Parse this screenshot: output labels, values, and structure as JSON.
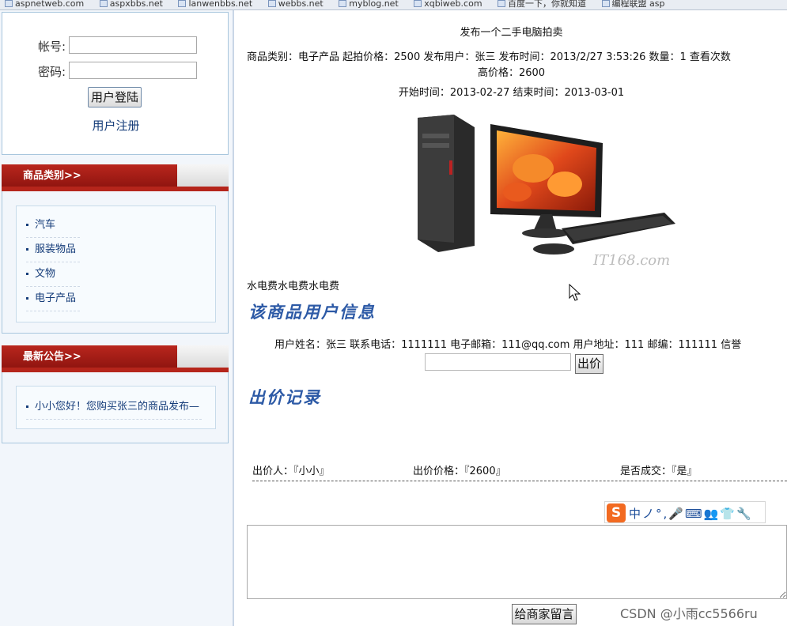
{
  "bookmarks": [
    "aspnetweb.com",
    "aspxbbs.net",
    "lanwenbbs.net",
    "webbs.net",
    "myblog.net",
    "xqbiweb.com",
    "百度一下，你就知道",
    "编程联盟 asp"
  ],
  "login": {
    "account_label": "帐号:",
    "password_label": "密码:",
    "login_button": "用户登陆",
    "register_link": "用户注册"
  },
  "categories_panel": {
    "title": "商品类别>>",
    "items": [
      "汽车",
      "服装物品",
      "文物",
      "电子产品"
    ]
  },
  "notice_panel": {
    "title": "最新公告>>",
    "items": [
      "小小您好！您购买张三的商品发布—"
    ]
  },
  "product": {
    "title": "发布一个二手电脑拍卖",
    "info_line": "商品类别：电子产品 起拍价格：2500 发布用户：张三 发布时间：2013/2/27 3:53:26 数量：1 查看次数",
    "highest_price": "高价格：2600",
    "time_line": "开始时间：2013-02-27 结束时间：2013-03-01",
    "image_watermark": "IT168.com",
    "description": "水电费水电费水电费"
  },
  "seller_section": {
    "title": "该商品用户信息",
    "info_line": "用户姓名：张三 联系电话：1111111 电子邮箱：111@qq.com 用户地址：111 邮编：111111 信誉"
  },
  "bid": {
    "button": "出价"
  },
  "records_section": {
    "title": "出价记录",
    "records": [
      {
        "bidder": "出价人：『小小』",
        "price": "出价价格：『2600』",
        "deal": "是否成交：『是』"
      }
    ]
  },
  "ime": {
    "logo": "S",
    "text": "中ノ°,🎤⌨👥👕🔧"
  },
  "message_button": "给商家留言",
  "watermark": "CSDN @小雨cc5566ru"
}
